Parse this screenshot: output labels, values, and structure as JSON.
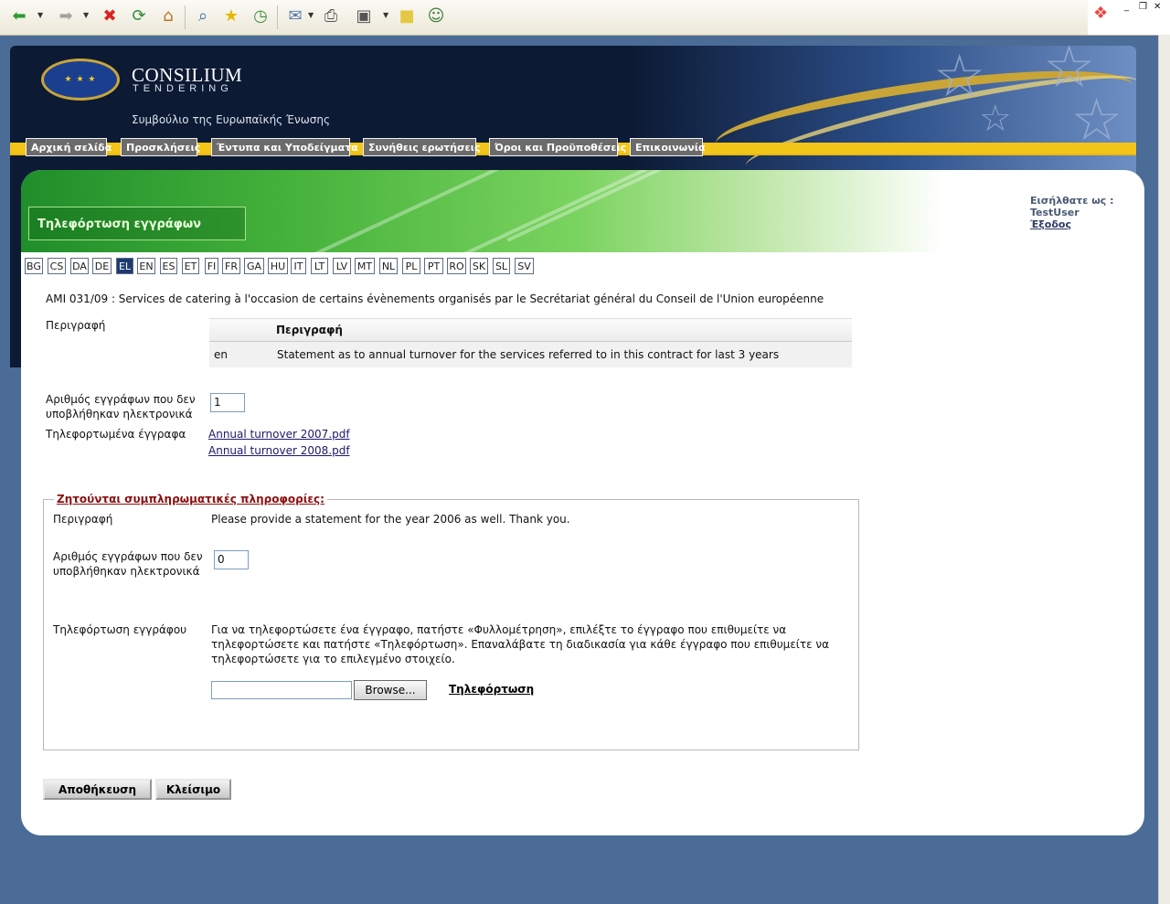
{
  "header": {
    "brand": "CONSILIUM",
    "brand_sub": "TENDERING",
    "council": "Συμβούλιο της Ευρωπαϊκής Ένωσης",
    "nav": [
      "Αρχική σελίδα",
      "Προσκλήσεις",
      "Έντυπα και Υποδείγματα",
      "Συνήθεις ερωτήσεις",
      "Όροι και Προϋποθέσεις",
      "Επικοινωνία"
    ]
  },
  "page": {
    "title": "Τηλεφόρτωση εγγράφων"
  },
  "user": {
    "logged_label": "Εισήλθατε ως :",
    "username": "TestUser",
    "logout": "Έξοδος"
  },
  "languages": [
    "BG",
    "CS",
    "DA",
    "DE",
    "EL",
    "EN",
    "ES",
    "ET",
    "FI",
    "FR",
    "GA",
    "HU",
    "IT",
    "LT",
    "LV",
    "MT",
    "NL",
    "PL",
    "PT",
    "RO",
    "SK",
    "SL",
    "SV"
  ],
  "active_language": "EL",
  "tender": {
    "title": "AMI 031/09 : Services de catering à l'occasion de certains évènements organisés par le Secrétariat général du Conseil de l'Union européenne",
    "description_label": "Περιγραφή",
    "table_header": "Περιγραφή",
    "table_lang": "en",
    "table_text": "Statement as to annual turnover for the services referred to in this contract for last 3 years",
    "not_submitted_label": "Αριθμός εγγράφων που δεν υποβλήθηκαν ηλεκτρονικά",
    "not_submitted_value": "1",
    "uploaded_label": "Τηλεφορτωμένα έγγραφα",
    "uploaded_files": [
      "Annual turnover 2007.pdf",
      "Annual turnover 2008.pdf"
    ]
  },
  "additional": {
    "legend": "Ζητούνται συμπληρωματικές πληροφορίες:",
    "description_label": "Περιγραφή",
    "description_text": "Please provide a statement for the year 2006 as well. Thank you.",
    "not_submitted_label": "Αριθμός εγγράφων που δεν υποβλήθηκαν ηλεκτρονικά",
    "not_submitted_value": "0",
    "upload_label": "Τηλεφόρτωση εγγράφου",
    "upload_help": "Για να τηλεφορτώσετε ένα έγγραφο, πατήστε «Φυλλομέτρηση», επιλέξτε το έγγραφο που επιθυμείτε να τηλεφορτώσετε και πατήστε «Τηλεφόρτωση». Επαναλάβατε τη διαδικασία για κάθε έγγραφο που επιθυμείτε να τηλεφορτώσετε για το επιλεγμένο στοιχείο.",
    "browse_button": "Browse...",
    "upload_button": "Τηλεφόρτωση"
  },
  "actions": {
    "save": "Αποθήκευση",
    "close": "Κλείσιμο"
  },
  "colors": {
    "page_bg": "#4a6c96",
    "header_bg": "#0c1a34",
    "nav_bar": "#f3c518",
    "legend": "#8b1010"
  }
}
